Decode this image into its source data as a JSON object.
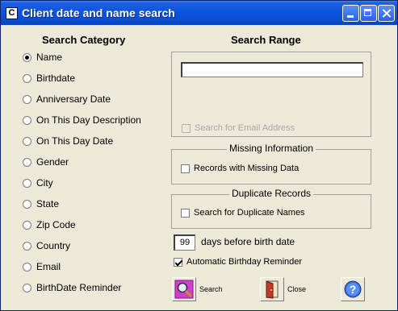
{
  "window": {
    "title": "Client date and name search",
    "icon_letter": "C"
  },
  "search_category": {
    "heading": "Search Category",
    "options": [
      {
        "label": "Name",
        "selected": true
      },
      {
        "label": "Birthdate",
        "selected": false
      },
      {
        "label": "Anniversary Date",
        "selected": false
      },
      {
        "label": "On This Day Description",
        "selected": false
      },
      {
        "label": "On This Day Date",
        "selected": false
      },
      {
        "label": "Gender",
        "selected": false
      },
      {
        "label": "City",
        "selected": false
      },
      {
        "label": "State",
        "selected": false
      },
      {
        "label": "Zip Code",
        "selected": false
      },
      {
        "label": "Country",
        "selected": false
      },
      {
        "label": "Email",
        "selected": false
      },
      {
        "label": "BirthDate Reminder",
        "selected": false
      }
    ]
  },
  "search_range": {
    "heading": "Search Range",
    "input_value": "",
    "email_checkbox_label": "Search for Email Address"
  },
  "missing_info": {
    "title": "Missing Information",
    "checkbox_label": "Records with Missing Data"
  },
  "duplicates": {
    "title": "Duplicate Records",
    "checkbox_label": "Search for Duplicate Names"
  },
  "birthday": {
    "days_value": "99",
    "days_label": "days before birth date",
    "reminder_label": "Automatic Birthday Reminder",
    "reminder_checked": true
  },
  "buttons": {
    "search": "Search",
    "close": "Close"
  }
}
